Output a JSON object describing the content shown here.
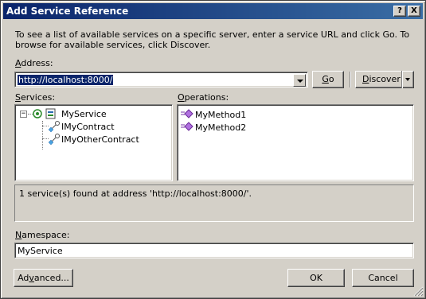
{
  "window": {
    "title": "Add Service Reference",
    "help_glyph": "?",
    "close_glyph": "X"
  },
  "description": "To see a list of available services on a specific server, enter a service URL and click Go. To browse for available services, click Discover.",
  "address": {
    "label_accel": "A",
    "label_rest": "ddress:",
    "value": "http://localhost:8000/"
  },
  "buttons": {
    "go_accel": "G",
    "go_rest": "o",
    "discover_accel": "D",
    "discover_rest": "iscover",
    "advanced_pre": "Ad",
    "advanced_accel": "v",
    "advanced_post": "anced...",
    "ok": "OK",
    "cancel": "Cancel"
  },
  "services": {
    "label_accel": "S",
    "label_rest": "ervices:",
    "expander_glyph": "−",
    "root": "MyService",
    "children": [
      "IMyContract",
      "IMyOtherContract"
    ]
  },
  "operations": {
    "label_accel": "O",
    "label_rest": "perations:",
    "items": [
      "MyMethod1",
      "MyMethod2"
    ]
  },
  "status": "1 service(s) found at address 'http://localhost:8000/'.",
  "namespace": {
    "label_accel": "N",
    "label_rest": "amespace:",
    "value": "MyService"
  },
  "colors": {
    "title_bar": "#0a246a",
    "selection": "#0a246a",
    "face": "#d4d0c8"
  },
  "icons": [
    "help-icon",
    "close-icon",
    "dropdown-arrow-icon",
    "service-icon",
    "contract-icon",
    "method-icon",
    "resize-grip-icon"
  ]
}
